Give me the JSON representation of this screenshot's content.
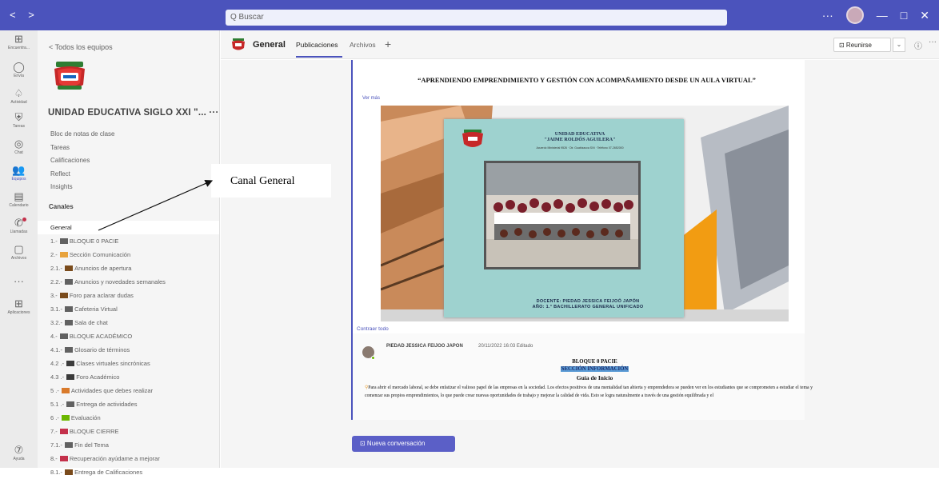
{
  "titlebar": {
    "nav_arrows": "< >",
    "search_placeholder": "Q Buscar",
    "window_controls": [
      "···",
      "—",
      "□",
      "✕"
    ]
  },
  "rail": [
    {
      "icon": "grid-icon",
      "label": "Encuentra...",
      "glyph": "⊞"
    },
    {
      "icon": "search-circle-icon",
      "label": "Envía",
      "glyph": "◯"
    },
    {
      "icon": "bell-icon",
      "label": "Actividad",
      "glyph": "♤"
    },
    {
      "icon": "shield-icon",
      "label": "Tareas",
      "glyph": "⛨"
    },
    {
      "icon": "chat-icon",
      "label": "Chat",
      "glyph": "◎"
    },
    {
      "icon": "teams-icon",
      "label": "Equipos",
      "glyph": "👥"
    },
    {
      "icon": "calendar-icon",
      "label": "Calendario",
      "glyph": "▤"
    },
    {
      "icon": "phone-icon",
      "label": "Llamadas",
      "glyph": "✆"
    },
    {
      "icon": "file-icon",
      "label": "Archivos",
      "glyph": "▢"
    },
    {
      "icon": "more-icon",
      "label": "",
      "glyph": "···"
    },
    {
      "icon": "apps-icon",
      "label": "Aplicaciones",
      "glyph": "⊞"
    }
  ],
  "rail_help": {
    "icon": "help-icon",
    "label": "Ayuda",
    "glyph": "⑦"
  },
  "sidebar": {
    "back": "<  Todos los equipos",
    "team_name": "UNIDAD EDUCATIVA SIGLO XXI \"...  ···",
    "team_links": [
      "Bloc de notas de clase",
      "Tareas",
      "Calificaciones",
      "Reflect",
      "Insights"
    ],
    "channels_header": "Canales",
    "channels": [
      {
        "label": "General",
        "color": ""
      },
      {
        "label": "1.- BLOQUE 0 PACIE",
        "color": "#616161"
      },
      {
        "label": "2.- Sección Comunicación",
        "color": "#e8a33d"
      },
      {
        "label": "2.1.- Anuncios de apertura",
        "color": "#7a4b1c"
      },
      {
        "label": "2.2.- Anuncios y novedades semanales",
        "color": "#616161"
      },
      {
        "label": "3.- Foro para aclarar dudas",
        "color": "#7a4b1c"
      },
      {
        "label": "3.1.- Cafeteria Virtual",
        "color": "#616161"
      },
      {
        "label": "3.2.- Sala de chat",
        "color": "#616161"
      },
      {
        "label": "4.- BLOQUE ACADÉMICO",
        "color": "#616161"
      },
      {
        "label": "4.1.- Glosario de términos",
        "color": "#616161"
      },
      {
        "label": "4.2 .- Clases virtuales sincrónicas",
        "color": "#3b3b3b"
      },
      {
        "label": "4.3 .- Foro Académico",
        "color": "#3b3b3b"
      },
      {
        "label": "5 .- Actividades que debes realizar",
        "color": "#d97a2b"
      },
      {
        "label": "5.1 .- Entrega de actividades",
        "color": "#616161"
      },
      {
        "label": "6 .- Evaluación",
        "color": "#6bb700"
      },
      {
        "label": "7.- BLOQUE CIERRE",
        "color": "#c4314b"
      },
      {
        "label": "7.1.- Fin del Tema",
        "color": "#616161"
      },
      {
        "label": "8.- Recuperación ayúdame a mejorar",
        "color": "#c4314b"
      },
      {
        "label": "8.1.- Entrega de Calificaciones",
        "color": "#7a4b1c"
      }
    ]
  },
  "header": {
    "channel": "General",
    "tabs": [
      "Publicaciones",
      "Archivos"
    ],
    "add_tab": "+",
    "meet_label": "⊡ Reunirse",
    "meet_dropdown": "⌄",
    "info": "ⓘ",
    "more": "···"
  },
  "post": {
    "title": "“APRENDIENDO EMPRENDIMIENTO Y GESTIÓN CON ACOMPAÑAMIENTO DESDE UN AULA VIRTUAL”",
    "see_more": "Ver más",
    "flyer": {
      "institution": "UNIDAD EDUCATIVA\n\"JAIME ROLDÓS AGUILERA\"",
      "address": "Acuerdo Ministerial 9526 · Dir. Guabizacca S/N · Teléfono 07-2652000",
      "teacher": "DOCENTE: PIEDAD JESSICA FEIJOÓ JAPÓN",
      "year": "AÑO: 1.° BACHILLERATO GENERAL UNIFICADO"
    },
    "collapse": "Contraer todo"
  },
  "reply": {
    "author": "PIEDAD JESSICA FEIJOO JAPON",
    "meta": "20/11/2022 16:03   Editado",
    "heading1": "BLOQUE 0 PACIE",
    "heading2": "SECCIÓN INFORMACIÓN",
    "heading3": "Guía de Inicio",
    "body": "Para abrir el mercado laboral, se debe enfatizar el valioso papel de las empresas en la sociedad. Los efectos positivos de una mentalidad tan abierta y emprendedora se pueden ver en los estudiantes que se comprometen a estudiar el tema y comenzar sus propios emprendimientos, lo que puede crear nuevas oportunidades de trabajo y mejorar la calidad de vida. Esto se logra naturalmente a través de una gestión equilibrada y el"
  },
  "new_conversation": "⊡  Nueva conversación",
  "annotation": "Canal General",
  "colors": {
    "brand": "#4b53bc",
    "button": "#5b5fc7",
    "rail": "#ebebeb",
    "sidebar": "#f5f5f5"
  }
}
